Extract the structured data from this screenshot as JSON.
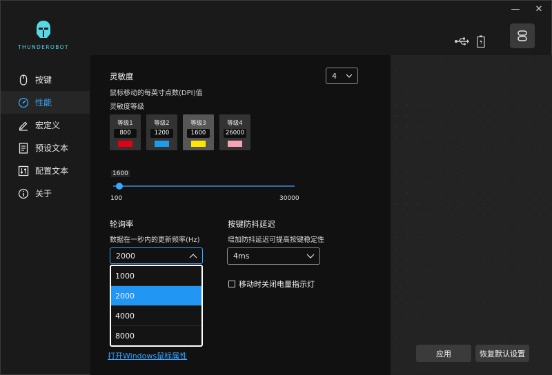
{
  "window": {
    "minimize_glyph": "—",
    "close_glyph": "✕"
  },
  "logo": {
    "text": "THUNDEROBOT",
    "color": "#56d8e4"
  },
  "status": {
    "usb_icon": "usb-icon",
    "battery_icon": "battery-icon",
    "device_icon": "device-profile-icon"
  },
  "sidebar": {
    "items": [
      {
        "label": "按键",
        "icon": "mouse-icon",
        "active": false
      },
      {
        "label": "性能",
        "icon": "speedometer-icon",
        "active": true
      },
      {
        "label": "宏定义",
        "icon": "pencil-icon",
        "active": false
      },
      {
        "label": "预设文本",
        "icon": "document-icon",
        "active": false
      },
      {
        "label": "配置文本",
        "icon": "sliders-icon",
        "active": false
      },
      {
        "label": "关于",
        "icon": "info-icon",
        "active": false
      }
    ]
  },
  "sensitivity": {
    "title": "灵敏度",
    "description": "鼠标移动的每英寸点数(DPI)值",
    "levels_title": "灵敏度等级",
    "level_count_selected": "4",
    "levels": [
      {
        "name": "等级1",
        "value": "800",
        "color": "#e30012"
      },
      {
        "name": "等级2",
        "value": "1200",
        "color": "#1e9bea"
      },
      {
        "name": "等级3",
        "value": "1600",
        "color": "#ffe600",
        "active": true
      },
      {
        "name": "等级4",
        "value": "26000",
        "color": "#f5a3b5"
      }
    ],
    "slider": {
      "value": "1600",
      "min": "100",
      "max": "30000"
    }
  },
  "polling": {
    "title": "轮询率",
    "description": "数据在一秒内的更新频率(Hz)",
    "selected": "2000",
    "options": [
      "1000",
      "2000",
      "4000",
      "8000"
    ],
    "highlighted_index": 1
  },
  "debounce": {
    "title": "按键防抖延迟",
    "description": "增加防抖延迟可提高按键稳定性",
    "selected": "4ms"
  },
  "power_led": {
    "label": "移动时关闭电量指示灯",
    "checked": false
  },
  "windows_link": "打开Windows鼠标属性",
  "buttons": {
    "apply": "应用",
    "reset": "恢复默认设置"
  },
  "colors": {
    "accent": "#3aa7ff",
    "highlight": "#2196f3"
  }
}
